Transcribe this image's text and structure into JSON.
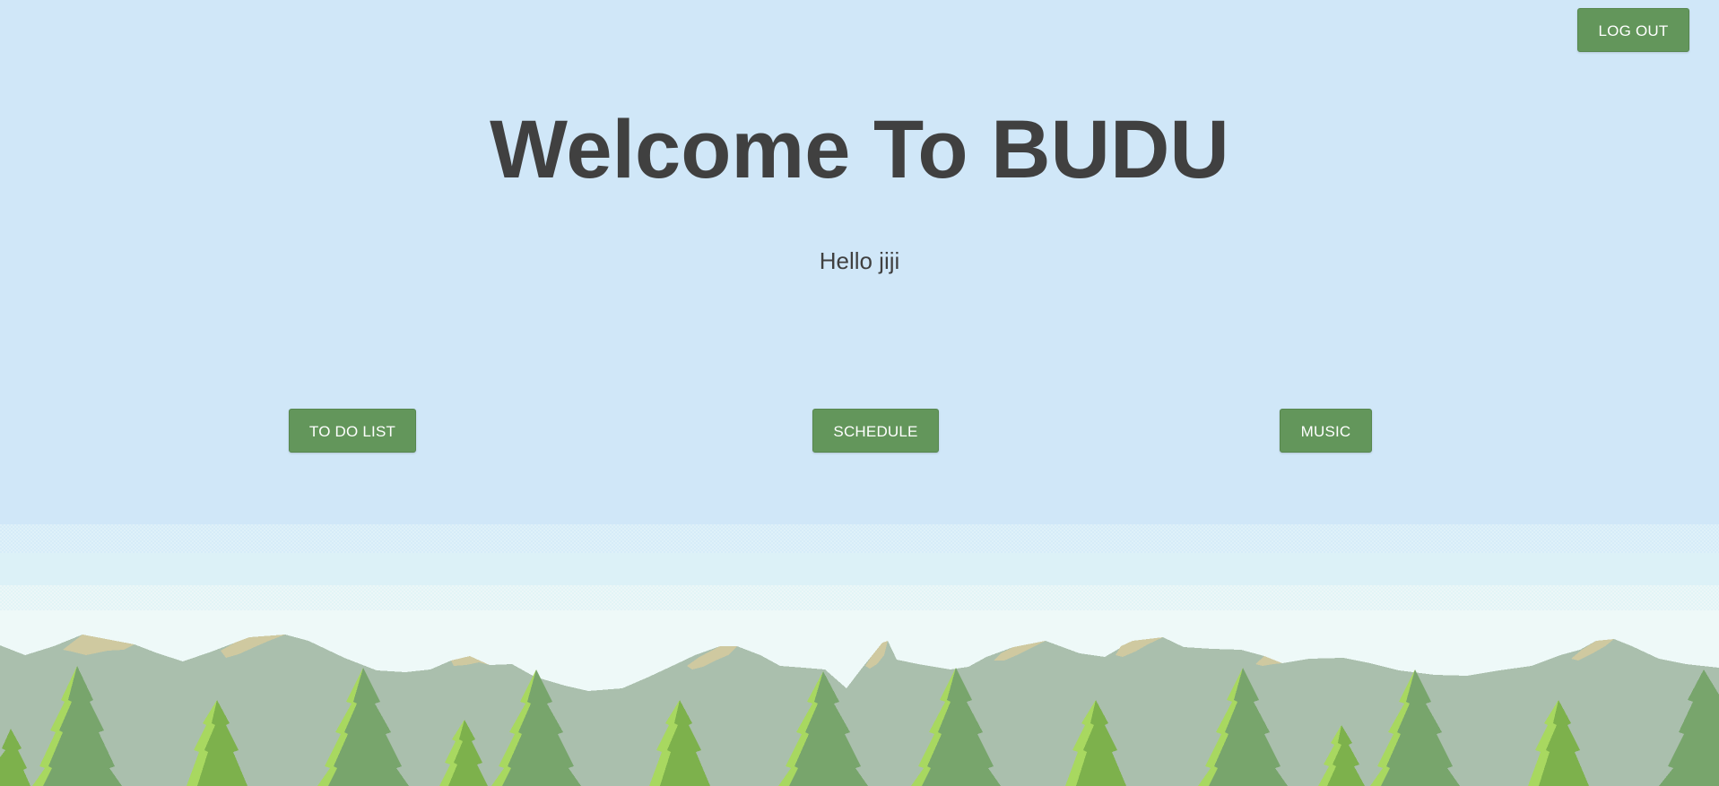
{
  "header": {
    "logout_label": "LOG OUT"
  },
  "main": {
    "title": "Welcome To BUDU",
    "greeting": "Hello jiji",
    "nav": {
      "todo_label": "TO DO LIST",
      "schedule_label": "SCHEDULE",
      "music_label": "MUSIC"
    }
  },
  "colors": {
    "sky": "#d0e7f8",
    "button": "#63965b",
    "button_text": "#ffffff",
    "text": "#404040",
    "mountain": "#aabfad",
    "mountain_peak": "#cfc9a0",
    "tree_dark": "#78a56c",
    "tree_light": "#7db14c",
    "tree_highlight": "#a8d860"
  }
}
